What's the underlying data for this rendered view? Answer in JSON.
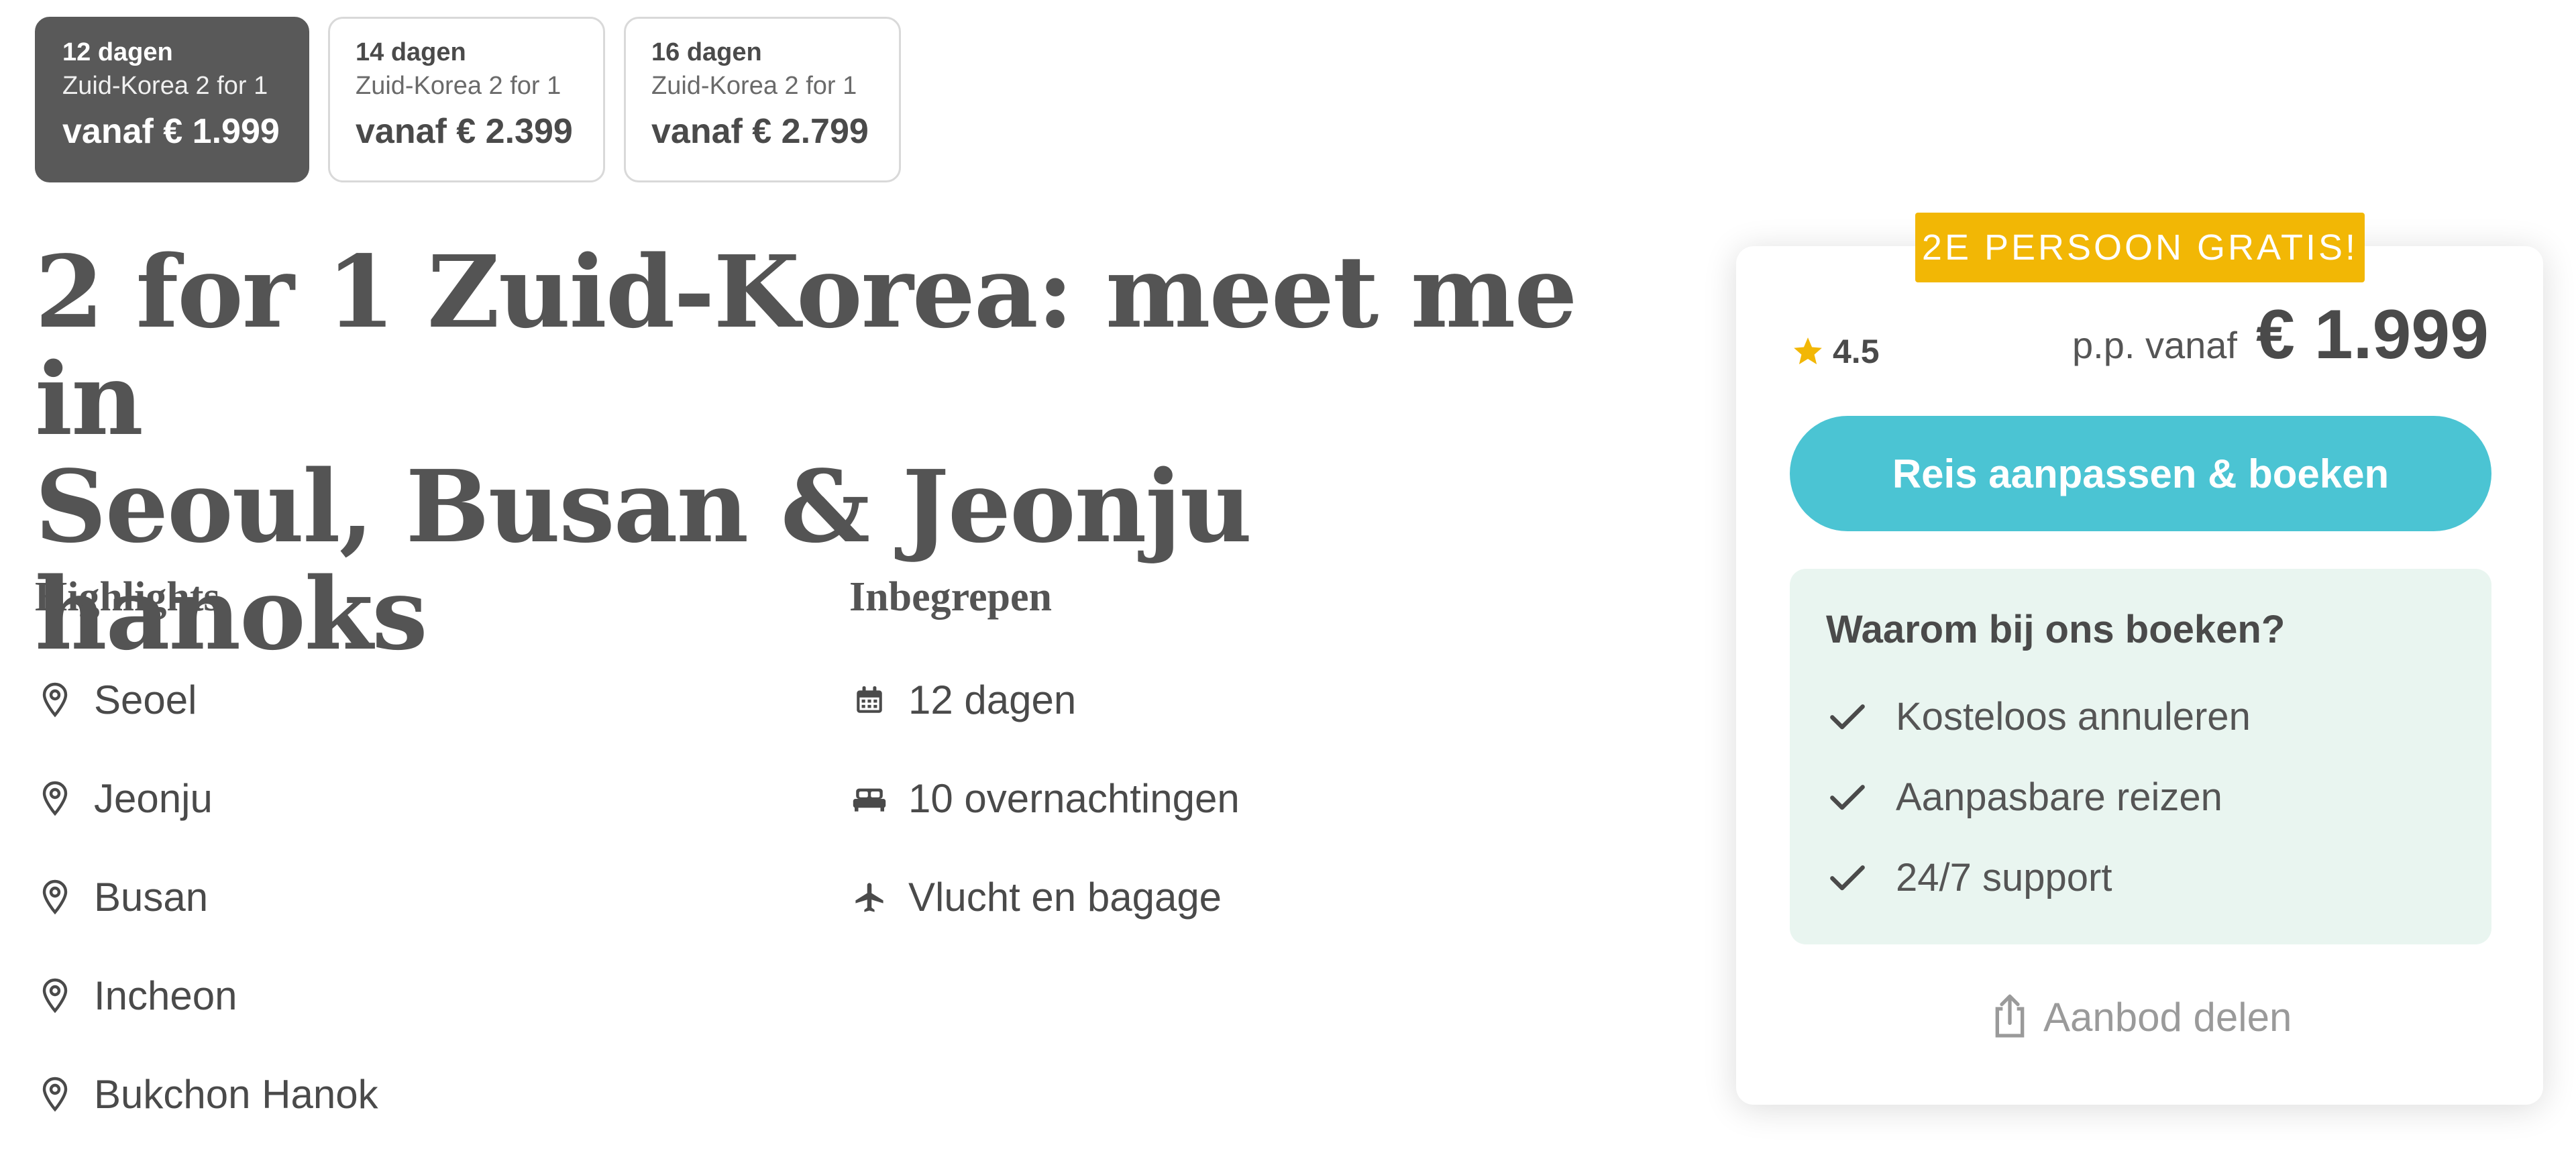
{
  "tabs": [
    {
      "days": "12 dagen",
      "name": "Zuid-Korea 2 for 1",
      "price": "vanaf € 1.999",
      "active": true
    },
    {
      "days": "14 dagen",
      "name": "Zuid-Korea 2 for 1",
      "price": "vanaf € 2.399",
      "active": false
    },
    {
      "days": "16 dagen",
      "name": "Zuid-Korea 2 for 1",
      "price": "vanaf € 2.799",
      "active": false
    }
  ],
  "title_line1": "2 for 1 Zuid-Korea: meet me in",
  "title_line2": "Seoul, Busan & Jeonju hanoks",
  "highlights": {
    "heading": "Highlights",
    "items": [
      "Seoel",
      "Jeonju",
      "Busan",
      "Incheon",
      "Bukchon Hanok"
    ],
    "icon": "map-pin-icon"
  },
  "included": {
    "heading": "Inbegrepen",
    "items": [
      {
        "icon": "calendar-icon",
        "label": "12 dagen"
      },
      {
        "icon": "bed-icon",
        "label": "10 overnachtingen"
      },
      {
        "icon": "airplane-icon",
        "label": "Vlucht en bagage"
      }
    ]
  },
  "card": {
    "ribbon": "2E PERSOON GRATIS!",
    "rating": "4.5",
    "price_label": "p.p. vanaf",
    "price": "€ 1.999",
    "cta": "Reis aanpassen & boeken",
    "why_heading": "Waarom bij ons boeken?",
    "why_items": [
      "Kosteloos annuleren",
      "Aanpasbare reizen",
      "24/7 support"
    ],
    "share": "Aanbod delen"
  },
  "colors": {
    "accent": "#4bc4d3",
    "ribbon": "#f2b705",
    "active_tab": "#595959",
    "why_bg": "#e9f5f0",
    "star": "#f2b705"
  }
}
